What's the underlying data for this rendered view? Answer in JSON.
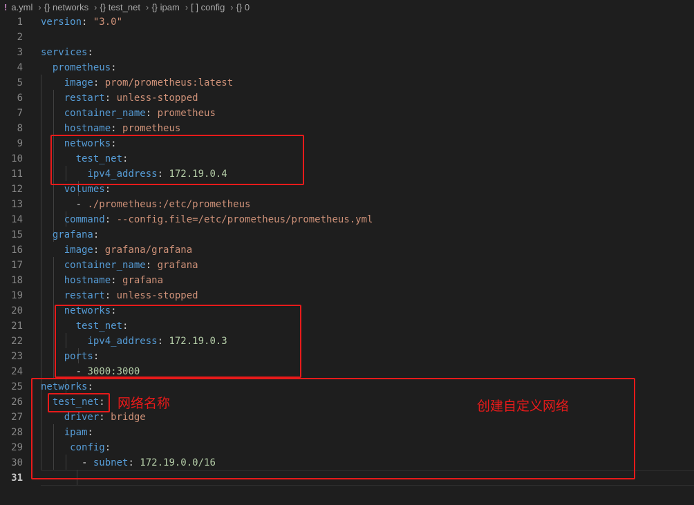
{
  "breadcrumb": {
    "file": "a.yml",
    "segments": [
      "{} networks",
      "{} test_net",
      "{} ipam",
      "[ ] config",
      "{} 0"
    ]
  },
  "editor": {
    "active_line": "31",
    "lines": [
      {
        "n": "1",
        "tokens": [
          {
            "t": "version",
            "c": "key"
          },
          {
            "t": ": ",
            "c": "punct"
          },
          {
            "t": "\"3.0\"",
            "c": "str"
          }
        ]
      },
      {
        "n": "2",
        "tokens": []
      },
      {
        "n": "3",
        "tokens": [
          {
            "t": "services",
            "c": "key"
          },
          {
            "t": ":",
            "c": "punct"
          }
        ]
      },
      {
        "n": "4",
        "tokens": [
          {
            "t": "  "
          },
          {
            "t": "prometheus",
            "c": "key"
          },
          {
            "t": ":",
            "c": "punct"
          }
        ]
      },
      {
        "n": "5",
        "tokens": [
          {
            "t": "    "
          },
          {
            "t": "image",
            "c": "key"
          },
          {
            "t": ": ",
            "c": "punct"
          },
          {
            "t": "prom/prometheus:latest",
            "c": "str"
          }
        ]
      },
      {
        "n": "6",
        "tokens": [
          {
            "t": "    "
          },
          {
            "t": "restart",
            "c": "key"
          },
          {
            "t": ": ",
            "c": "punct"
          },
          {
            "t": "unless-stopped",
            "c": "str"
          }
        ]
      },
      {
        "n": "7",
        "tokens": [
          {
            "t": "    "
          },
          {
            "t": "container_name",
            "c": "key"
          },
          {
            "t": ": ",
            "c": "punct"
          },
          {
            "t": "prometheus",
            "c": "str"
          }
        ]
      },
      {
        "n": "8",
        "tokens": [
          {
            "t": "    "
          },
          {
            "t": "hostname",
            "c": "key"
          },
          {
            "t": ": ",
            "c": "punct"
          },
          {
            "t": "prometheus",
            "c": "str"
          }
        ]
      },
      {
        "n": "9",
        "tokens": [
          {
            "t": "    "
          },
          {
            "t": "networks",
            "c": "key"
          },
          {
            "t": ":",
            "c": "punct"
          }
        ]
      },
      {
        "n": "10",
        "tokens": [
          {
            "t": "      "
          },
          {
            "t": "test_net",
            "c": "key"
          },
          {
            "t": ":",
            "c": "punct"
          }
        ]
      },
      {
        "n": "11",
        "tokens": [
          {
            "t": "        "
          },
          {
            "t": "ipv4_address",
            "c": "key"
          },
          {
            "t": ": ",
            "c": "punct"
          },
          {
            "t": "172.19.0.4",
            "c": "num"
          }
        ]
      },
      {
        "n": "12",
        "tokens": [
          {
            "t": "    "
          },
          {
            "t": "volumes",
            "c": "key"
          },
          {
            "t": ":",
            "c": "punct"
          }
        ]
      },
      {
        "n": "13",
        "tokens": [
          {
            "t": "      - ",
            "c": "punct"
          },
          {
            "t": "./prometheus:/etc/prometheus",
            "c": "str"
          }
        ]
      },
      {
        "n": "14",
        "tokens": [
          {
            "t": "    "
          },
          {
            "t": "command",
            "c": "key"
          },
          {
            "t": ": ",
            "c": "punct"
          },
          {
            "t": "--config.file=/etc/prometheus/prometheus.yml",
            "c": "str"
          }
        ]
      },
      {
        "n": "15",
        "tokens": [
          {
            "t": "  "
          },
          {
            "t": "grafana",
            "c": "key"
          },
          {
            "t": ":",
            "c": "punct"
          }
        ]
      },
      {
        "n": "16",
        "tokens": [
          {
            "t": "    "
          },
          {
            "t": "image",
            "c": "key"
          },
          {
            "t": ": ",
            "c": "punct"
          },
          {
            "t": "grafana/grafana",
            "c": "str"
          }
        ]
      },
      {
        "n": "17",
        "tokens": [
          {
            "t": "    "
          },
          {
            "t": "container_name",
            "c": "key"
          },
          {
            "t": ": ",
            "c": "punct"
          },
          {
            "t": "grafana",
            "c": "str"
          }
        ]
      },
      {
        "n": "18",
        "tokens": [
          {
            "t": "    "
          },
          {
            "t": "hostname",
            "c": "key"
          },
          {
            "t": ": ",
            "c": "punct"
          },
          {
            "t": "grafana",
            "c": "str"
          }
        ]
      },
      {
        "n": "19",
        "tokens": [
          {
            "t": "    "
          },
          {
            "t": "restart",
            "c": "key"
          },
          {
            "t": ": ",
            "c": "punct"
          },
          {
            "t": "unless-stopped",
            "c": "str"
          }
        ]
      },
      {
        "n": "20",
        "tokens": [
          {
            "t": "    "
          },
          {
            "t": "networks",
            "c": "key"
          },
          {
            "t": ":",
            "c": "punct"
          }
        ]
      },
      {
        "n": "21",
        "tokens": [
          {
            "t": "      "
          },
          {
            "t": "test_net",
            "c": "key"
          },
          {
            "t": ":",
            "c": "punct"
          }
        ]
      },
      {
        "n": "22",
        "tokens": [
          {
            "t": "        "
          },
          {
            "t": "ipv4_address",
            "c": "key"
          },
          {
            "t": ": ",
            "c": "punct"
          },
          {
            "t": "172.19.0.3",
            "c": "num"
          }
        ]
      },
      {
        "n": "23",
        "tokens": [
          {
            "t": "    "
          },
          {
            "t": "ports",
            "c": "key"
          },
          {
            "t": ":",
            "c": "punct"
          }
        ]
      },
      {
        "n": "24",
        "tokens": [
          {
            "t": "      - ",
            "c": "punct"
          },
          {
            "t": "3000:3000",
            "c": "num"
          }
        ]
      },
      {
        "n": "25",
        "tokens": [
          {
            "t": "networks",
            "c": "key"
          },
          {
            "t": ":",
            "c": "punct"
          }
        ]
      },
      {
        "n": "26",
        "tokens": [
          {
            "t": "  "
          },
          {
            "t": "test_net",
            "c": "key"
          },
          {
            "t": ":",
            "c": "punct"
          }
        ]
      },
      {
        "n": "27",
        "tokens": [
          {
            "t": "    "
          },
          {
            "t": "driver",
            "c": "key"
          },
          {
            "t": ": ",
            "c": "punct"
          },
          {
            "t": "bridge",
            "c": "str"
          }
        ]
      },
      {
        "n": "28",
        "tokens": [
          {
            "t": "    "
          },
          {
            "t": "ipam",
            "c": "key"
          },
          {
            "t": ":",
            "c": "punct"
          }
        ]
      },
      {
        "n": "29",
        "tokens": [
          {
            "t": "     "
          },
          {
            "t": "config",
            "c": "key"
          },
          {
            "t": ":",
            "c": "punct"
          }
        ]
      },
      {
        "n": "30",
        "tokens": [
          {
            "t": "       - ",
            "c": "punct"
          },
          {
            "t": "subnet",
            "c": "key"
          },
          {
            "t": ": ",
            "c": "punct"
          },
          {
            "t": "172.19.0.0/16",
            "c": "num"
          }
        ]
      },
      {
        "n": "31",
        "tokens": []
      }
    ]
  },
  "annotations": {
    "network_name": "网络名称",
    "custom_network": "创建自定义网络"
  },
  "colors": {
    "background": "#1e1e1e",
    "key": "#569cd6",
    "string": "#ce9178",
    "number": "#b5cea8",
    "annotation_red": "#e81a1a"
  }
}
